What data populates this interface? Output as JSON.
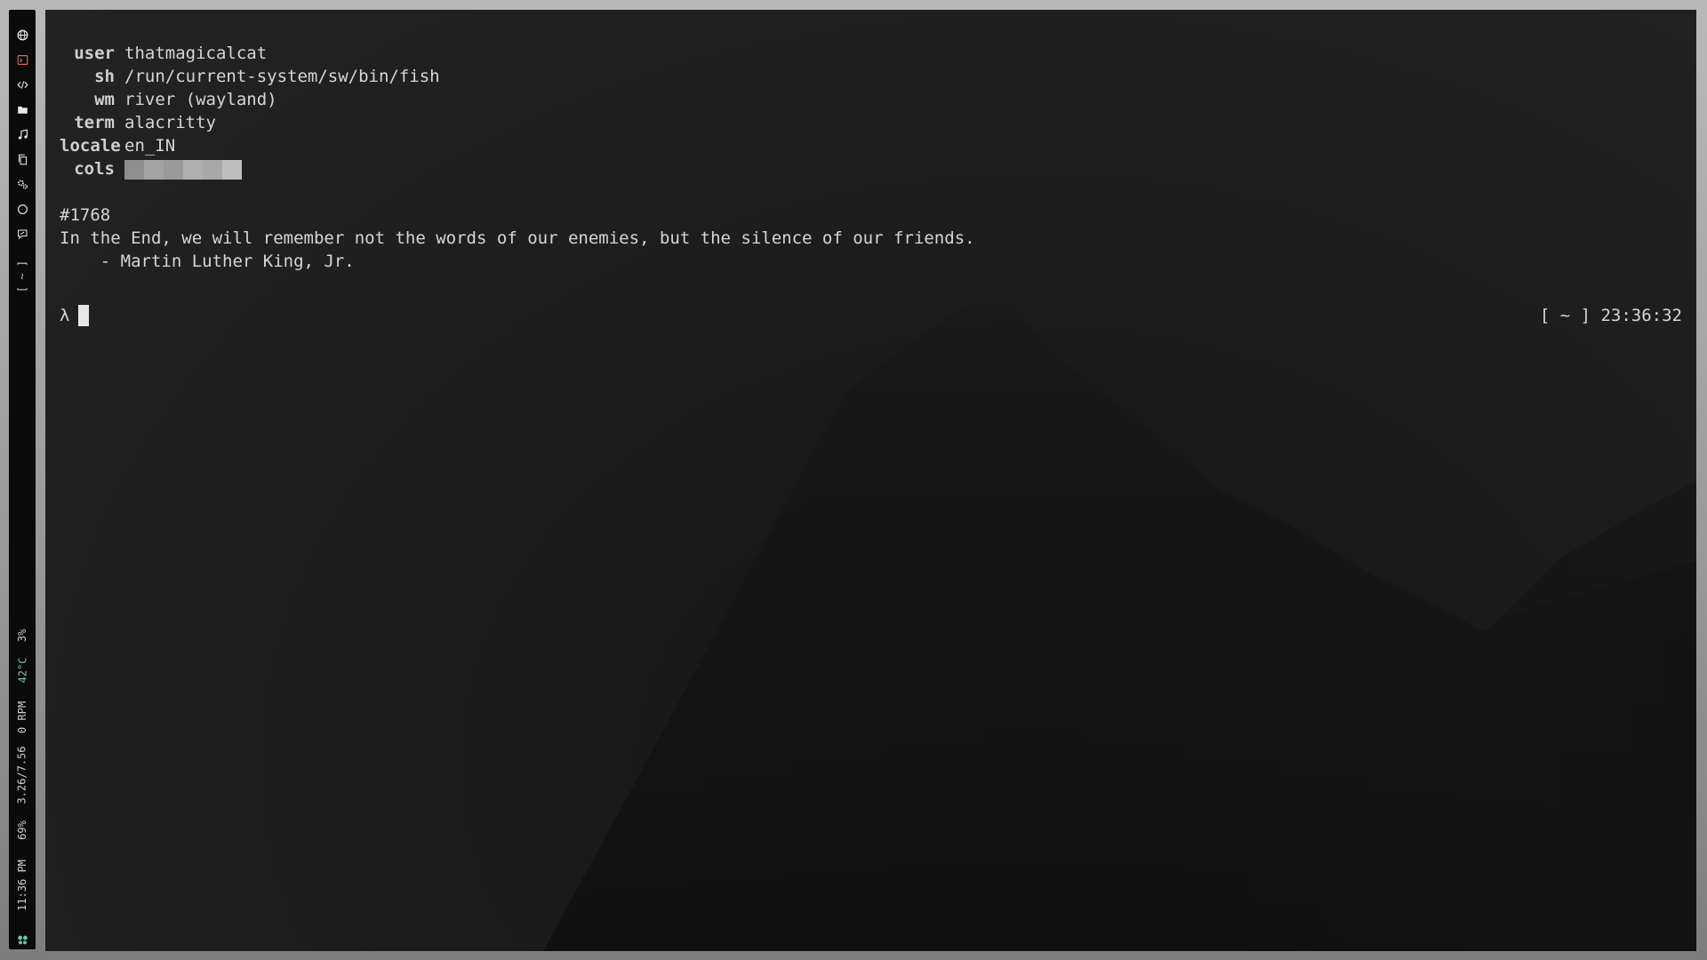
{
  "bar": {
    "icons": [
      "globe-icon",
      "terminal-icon",
      "code-icon",
      "folder-icon",
      "music-icon",
      "copy-icon",
      "settings-icon",
      "circle-icon",
      "chat-icon"
    ],
    "workspace": "[ ~ ]",
    "cpu": "3%",
    "temp": "42°C",
    "fan": "0 RPM",
    "memory": "3.26/7.56",
    "battery": "69%",
    "clock": "11:36 PM",
    "launcher_icon": "butterfly-icon",
    "colors": {
      "bar_bg": "#0b0b0b",
      "text": "#cfcfcf",
      "temp": "#7fbfa8",
      "launcher": "#6ec9a2",
      "terminal_icon": "#d46a6a"
    }
  },
  "terminal": {
    "info": [
      {
        "key": "user",
        "value": "thatmagicalcat"
      },
      {
        "key": "sh",
        "value": "/run/current-system/sw/bin/fish"
      },
      {
        "key": "wm",
        "value": "river (wayland)"
      },
      {
        "key": "term",
        "value": "alacritty"
      },
      {
        "key": "locale",
        "value": "en_IN"
      },
      {
        "key": "cols",
        "value": ""
      }
    ],
    "cols_swatches": [
      "#8f8f8f",
      "#a3a3a3",
      "#9a9a9a",
      "#b0b0b0",
      "#a8a8a8",
      "#bebebe"
    ],
    "quote_id": "#1768",
    "quote": "In the End, we will remember not the words of our enemies, but the silence of our friends.",
    "author": "    - Martin Luther King, Jr.",
    "prompt_symbol": "λ",
    "right_prompt": "[ ~ ] 23:36:32"
  }
}
